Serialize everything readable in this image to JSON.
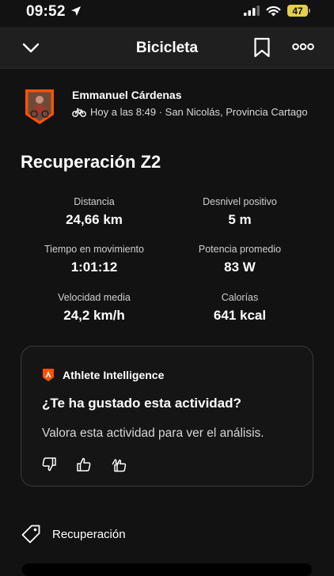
{
  "status_bar": {
    "time": "09:52",
    "battery": "47"
  },
  "nav": {
    "title": "Bicicleta"
  },
  "activity": {
    "athlete_name": "Emmanuel Cárdenas",
    "meta": "Hoy a las 8:49 · San Nicolás, Provincia Cartago",
    "title": "Recuperación Z2",
    "stats": [
      {
        "label": "Distancia",
        "value": "24,66 km"
      },
      {
        "label": "Desnivel positivo",
        "value": "5 m"
      },
      {
        "label": "Tiempo en movimiento",
        "value": "1:01:12"
      },
      {
        "label": "Potencia promedio",
        "value": "83 W"
      },
      {
        "label": "Velocidad media",
        "value": "24,2 km/h"
      },
      {
        "label": "Calorías",
        "value": "641 kcal"
      }
    ]
  },
  "athlete_intelligence": {
    "label": "Athlete Intelligence",
    "question": "¿Te ha gustado esta actividad?",
    "subtitle": "Valora esta actividad para ver el análisis."
  },
  "tag": {
    "label": "Recuperación"
  },
  "colors": {
    "accent": "#fc5200",
    "battery": "#e6d04a",
    "background": "#121212",
    "navbar": "#1f1f1f"
  },
  "icons": [
    "location-arrow-icon",
    "signal-icon",
    "wifi-icon",
    "battery-icon",
    "chevron-down-icon",
    "bookmark-icon",
    "more-icon",
    "bike-icon",
    "athlete-intelligence-icon",
    "thumbs-down-icon",
    "thumbs-up-icon",
    "double-thumbs-up-icon",
    "tag-icon"
  ]
}
